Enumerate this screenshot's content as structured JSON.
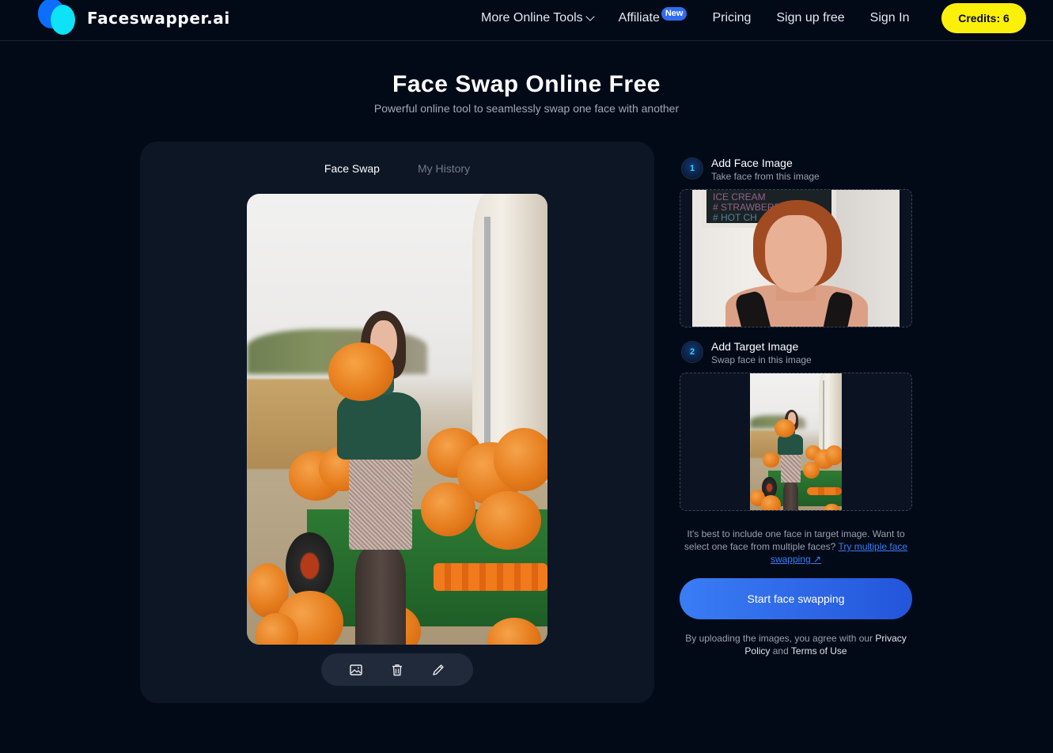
{
  "header": {
    "brand": "Faceswapper.ai",
    "nav": [
      {
        "label": "More Online Tools",
        "has_dropdown": true
      },
      {
        "label": "Affiliate",
        "badge": "New"
      },
      {
        "label": "Pricing"
      },
      {
        "label": "Sign up free"
      },
      {
        "label": "Sign In"
      }
    ],
    "credits_label": "Credits: 6"
  },
  "hero": {
    "title": "Face Swap Online Free",
    "subtitle": "Powerful online tool to seamlessly swap one face with another"
  },
  "panel": {
    "tabs": [
      {
        "label": "Face Swap",
        "active": true
      },
      {
        "label": "My History",
        "active": false
      }
    ],
    "preview_alt": "Woman in green turtleneck holding a pumpkin beside a cart of pumpkins",
    "toolbar": [
      {
        "icon": "image-icon",
        "label": "Change image"
      },
      {
        "icon": "trash-icon",
        "label": "Delete"
      },
      {
        "icon": "pencil-icon",
        "label": "Edit"
      }
    ]
  },
  "steps": [
    {
      "number": "1",
      "title": "Add Face Image",
      "subtitle": "Take face from this image",
      "image_alt": "Red-haired woman portrait",
      "board_lines": [
        "ICE CREAM",
        "# STRAWBERRY",
        "# HOT CH"
      ]
    },
    {
      "number": "2",
      "title": "Add Target Image",
      "subtitle": "Swap face in this image",
      "image_alt": "Woman holding pumpkin"
    }
  ],
  "hint": {
    "text": "It's best to include one face in target image. Want to select one face from multiple faces?",
    "link": "Try multiple face swapping ↗"
  },
  "start_button": "Start face swapping",
  "legal": {
    "prefix": "By uploading the images, you agree with our",
    "privacy": "Privacy Policy",
    "and": "and",
    "terms": "Terms of Use"
  },
  "colors": {
    "background": "#020a18",
    "panel": "#0d1625",
    "accent_blue": "#3a7df5",
    "credits_yellow": "#fbf00a",
    "badge_blue": "#2f6cf0",
    "step_number": "#3bd3f6"
  }
}
